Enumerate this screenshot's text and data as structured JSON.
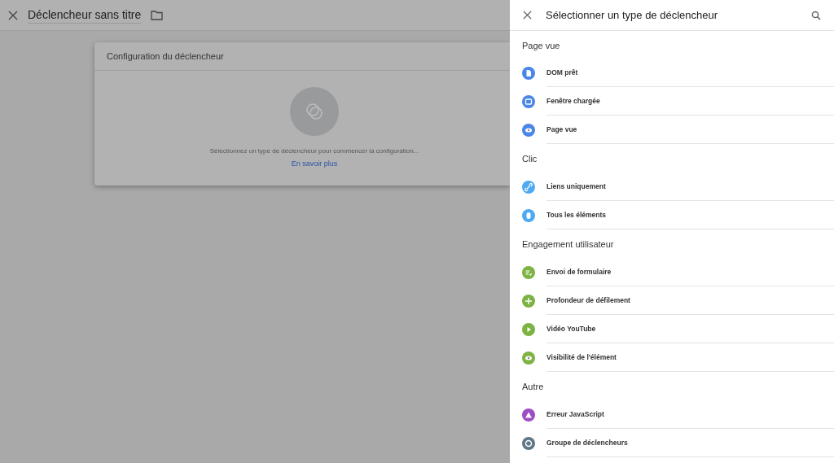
{
  "editor": {
    "title": "Déclencheur sans titre",
    "card": {
      "title": "Configuration du déclencheur",
      "message": "Sélectionnez un type de déclencheur pour commencer la configuration...",
      "link": "En savoir plus"
    }
  },
  "panel": {
    "title": "Sélectionner un type de déclencheur",
    "sections": [
      {
        "heading": "Page vue",
        "items": [
          {
            "label": "DOM prêt",
            "kind": "document",
            "color": "#4a86e8"
          },
          {
            "label": "Fenêtre chargée",
            "kind": "window",
            "color": "#4a86e8"
          },
          {
            "label": "Page vue",
            "kind": "eye",
            "color": "#4a86e8"
          }
        ]
      },
      {
        "heading": "Clic",
        "items": [
          {
            "label": "Liens uniquement",
            "kind": "link",
            "color": "#4eaaf0"
          },
          {
            "label": "Tous les éléments",
            "kind": "mouse",
            "color": "#4eaaf0"
          }
        ]
      },
      {
        "heading": "Engagement utilisateur",
        "items": [
          {
            "label": "Envoi de formulaire",
            "kind": "form",
            "color": "#7cb342"
          },
          {
            "label": "Profondeur de défilement",
            "kind": "move",
            "color": "#7cb342"
          },
          {
            "label": "Vidéo YouTube",
            "kind": "play",
            "color": "#7cb342"
          },
          {
            "label": "Visibilité de l'élément",
            "kind": "eye",
            "color": "#7cb342"
          }
        ]
      },
      {
        "heading": "Autre",
        "items": [
          {
            "label": "Erreur JavaScript",
            "kind": "warning",
            "color": "#9c4dc4"
          },
          {
            "label": "Groupe de déclencheurs",
            "kind": "group",
            "color": "#5f7786"
          }
        ]
      }
    ]
  }
}
